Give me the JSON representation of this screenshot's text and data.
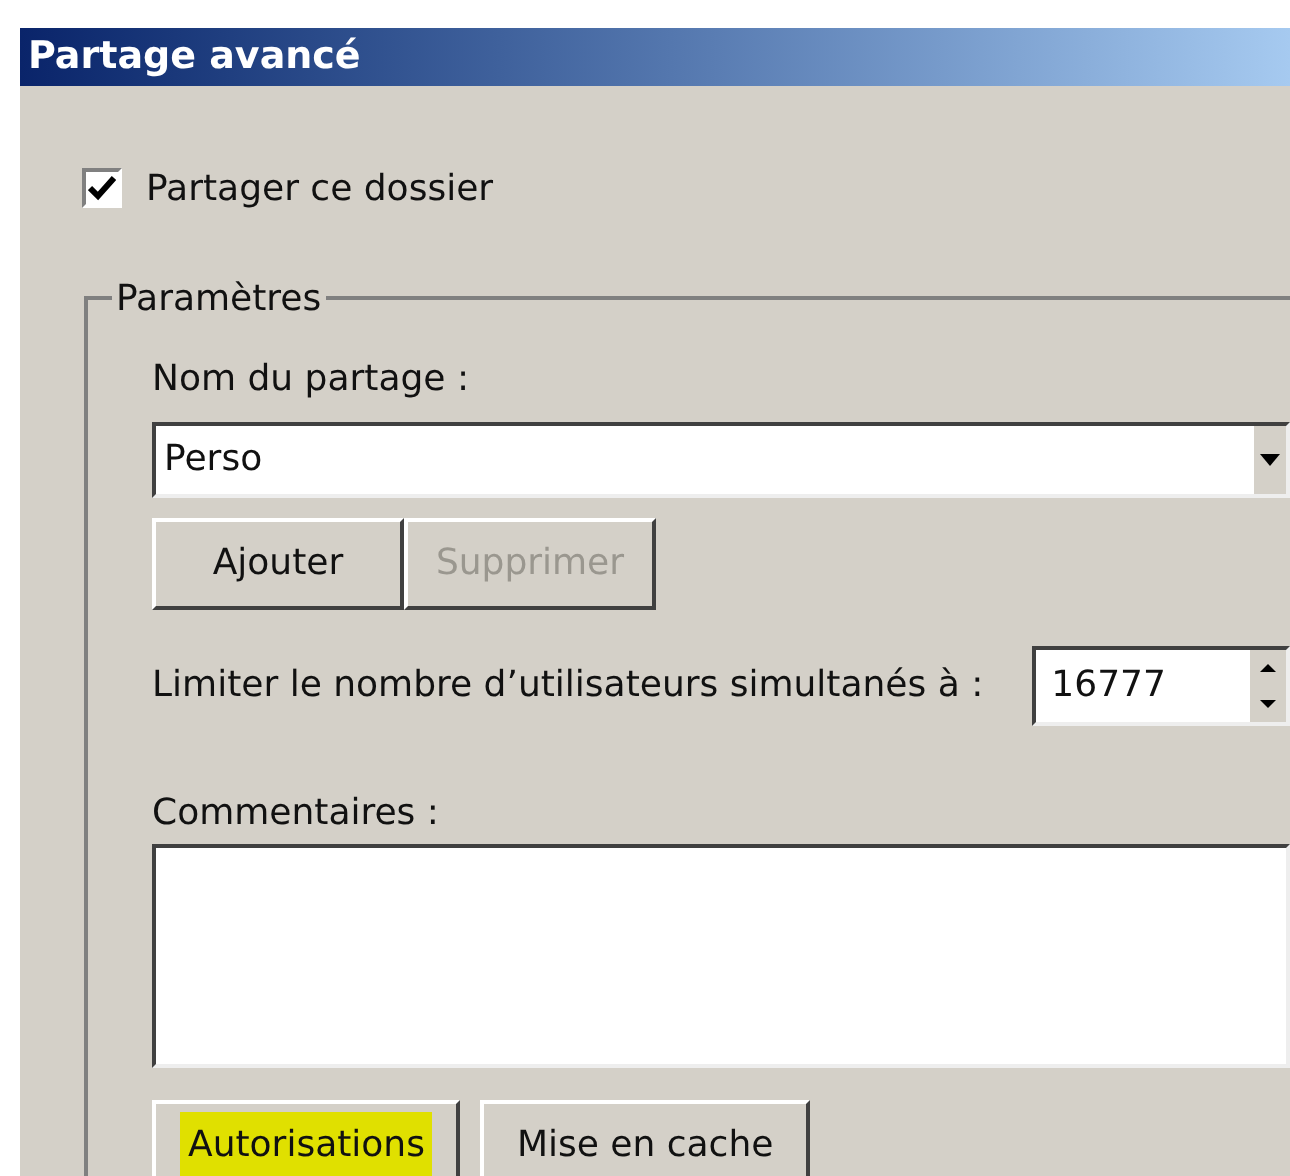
{
  "window": {
    "title": "Partage avancé"
  },
  "share_folder": {
    "label": "Partager ce dossier",
    "checked": true
  },
  "group": {
    "title": "Paramètres",
    "share_name": {
      "label": "Nom du partage :",
      "value": "Perso"
    },
    "buttons": [
      {
        "label": "Ajouter",
        "disabled": false
      },
      {
        "label": "Supprimer",
        "disabled": true
      }
    ],
    "user_limit": {
      "label": "Limiter le nombre d’utilisateurs simultanés à :",
      "value": "16777"
    },
    "comments": {
      "label": "Commentaires :"
    },
    "bottom_buttons": [
      {
        "label": "Autorisations",
        "highlighted": true
      },
      {
        "label": "Mise en cache",
        "highlighted": false
      }
    ]
  }
}
